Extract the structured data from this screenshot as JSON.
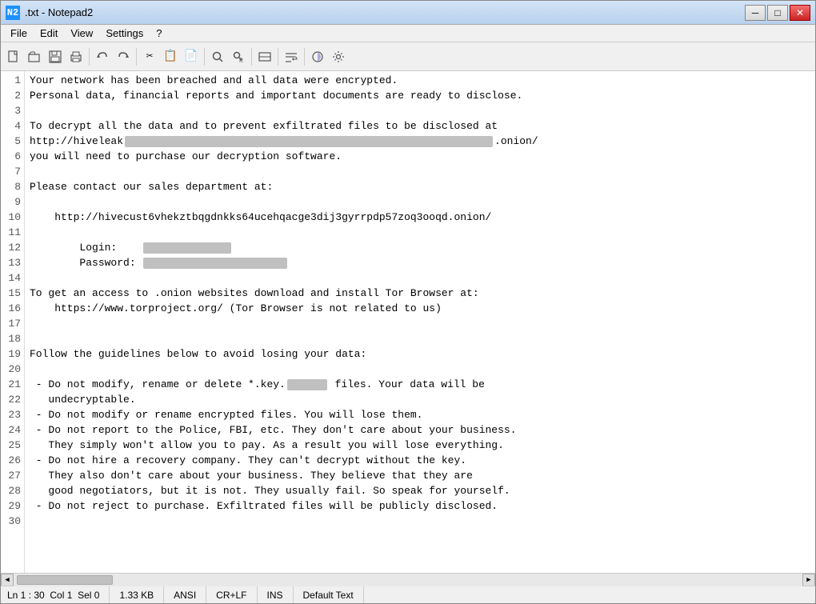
{
  "window": {
    "title": ".txt - Notepad2",
    "icon": "N2"
  },
  "titlebar": {
    "minimize_label": "─",
    "maximize_label": "□",
    "close_label": "✕"
  },
  "menu": {
    "items": [
      "File",
      "Edit",
      "View",
      "Settings",
      "?"
    ]
  },
  "toolbar": {
    "buttons": [
      "📄",
      "📂",
      "💾",
      "🖨",
      "✂",
      "📋",
      "📑",
      "↩",
      "↪",
      "✂",
      "📋",
      "📑",
      "🔍",
      "🔎",
      "🔲",
      "📊",
      "📐",
      "📏",
      "🔧"
    ]
  },
  "lines": [
    {
      "num": 1,
      "text": "Your network has been breached and all data were encrypted."
    },
    {
      "num": 2,
      "text": "Personal data, financial reports and important documents are ready to disclose."
    },
    {
      "num": 3,
      "text": ""
    },
    {
      "num": 4,
      "text": "To decrypt all the data and to prevent exfiltrated files to be disclosed at"
    },
    {
      "num": 5,
      "text": "http://hiveleak                                              .onion/",
      "redact5": true
    },
    {
      "num": 6,
      "text": "you will need to purchase our decryption software."
    },
    {
      "num": 7,
      "text": ""
    },
    {
      "num": 8,
      "text": "Please contact our sales department at:"
    },
    {
      "num": 9,
      "text": ""
    },
    {
      "num": 10,
      "text": "    http://hivecust6vhekztbqgdnkks64ucehqacge3dij3gyrrpdp57zoq3ooqd.onion/"
    },
    {
      "num": 11,
      "text": ""
    },
    {
      "num": 12,
      "text": "        Login:    ",
      "redact12": true
    },
    {
      "num": 13,
      "text": "        Password: ",
      "redact13": true
    },
    {
      "num": 14,
      "text": ""
    },
    {
      "num": 15,
      "text": "To get an access to .onion websites download and install Tor Browser at:"
    },
    {
      "num": 16,
      "text": "    https://www.torproject.org/ (Tor Browser is not related to us)"
    },
    {
      "num": 17,
      "text": ""
    },
    {
      "num": 18,
      "text": ""
    },
    {
      "num": 19,
      "text": "Follow the guidelines below to avoid losing your data:"
    },
    {
      "num": 20,
      "text": ""
    },
    {
      "num": 21,
      "text": " - Do not modify, rename or delete *.key.      files. Your data will be",
      "redact21": true
    },
    {
      "num": 22,
      "text": "   undecryptable."
    },
    {
      "num": 23,
      "text": " - Do not modify or rename encrypted files. You will lose them."
    },
    {
      "num": 24,
      "text": " - Do not report to the Police, FBI, etc. They don't care about your business."
    },
    {
      "num": 25,
      "text": "   They simply won't allow you to pay. As a result you will lose everything."
    },
    {
      "num": 26,
      "text": " - Do not hire a recovery company. They can't decrypt without the key."
    },
    {
      "num": 27,
      "text": "   They also don't care about your business. They believe that they are"
    },
    {
      "num": 28,
      "text": "   good negotiators, but it is not. They usually fail. So speak for yourself."
    },
    {
      "num": 29,
      "text": " - Do not reject to purchase. Exfiltrated files will be publicly disclosed."
    },
    {
      "num": 30,
      "text": ""
    }
  ],
  "statusbar": {
    "position": "Ln 1 : 30",
    "col": "Col 1",
    "sel": "Sel 0",
    "filesize": "1.33 KB",
    "encoding": "ANSI",
    "lineending": "CR+LF",
    "insert": "INS",
    "scheme": "Default Text"
  }
}
